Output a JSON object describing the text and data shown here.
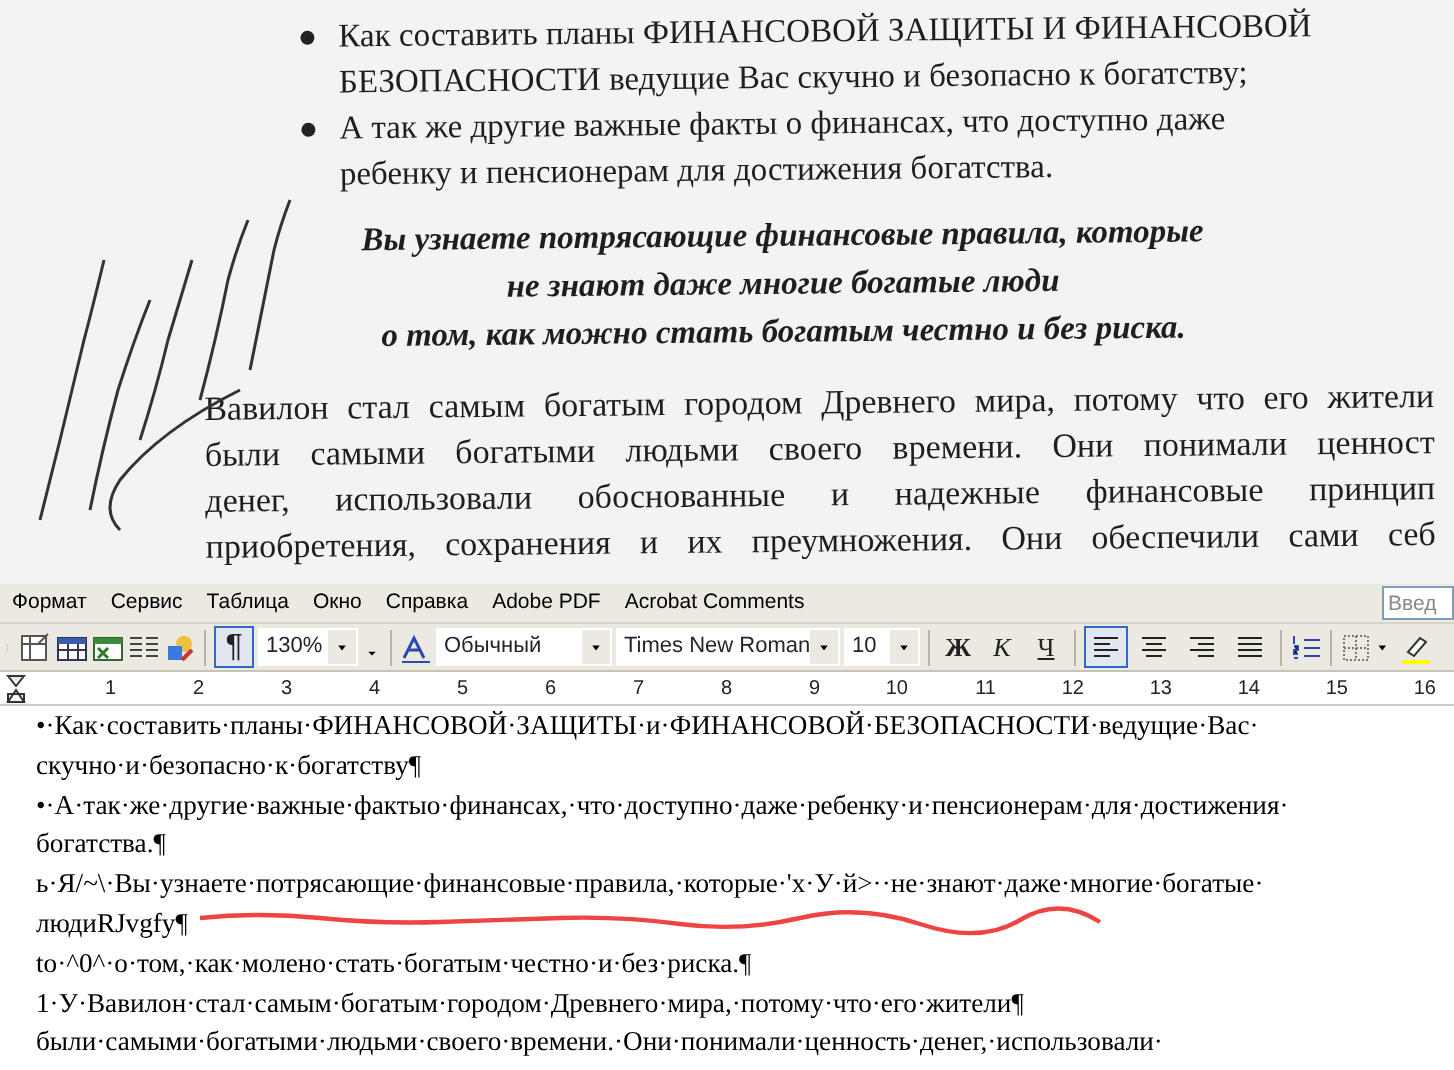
{
  "scan": {
    "bullets": [
      {
        "lines": [
          "Как составить планы ФИНАНСОВОЙ ЗАЩИТЫ И ФИНАНСОВОЙ",
          "БЕЗОПАСНОСТИ ведущие Вас скучно и безопасно к богатству;"
        ]
      },
      {
        "lines": [
          "А так же другие важные факты о финансах, что доступно даже",
          "ребенку и пенсионерам для достижения богатства."
        ]
      }
    ],
    "emphasis": [
      "Вы узнаете потрясающие финансовые правила, которые",
      "не знают даже многие богатые люди",
      "о том, как можно стать богатым честно и без риска."
    ],
    "paragraph": [
      "Вавилон стал самым богатым городом Древнего мира, потому что его жители",
      "были самыми богатыми людьми своего времени. Они понимали ценност",
      "денег, использовали обоснованные и надежные финансовые принцип",
      "приобретения, сохранения и их преумножения. Они обеспечили сами себ"
    ]
  },
  "menu": [
    {
      "label": "Формат"
    },
    {
      "label": "Сервис"
    },
    {
      "label": "Таблица"
    },
    {
      "label": "Окно"
    },
    {
      "label": "Справка"
    },
    {
      "label": "Adobe PDF"
    },
    {
      "label": "Acrobat Comments"
    }
  ],
  "help_box": {
    "placeholder": "Введ"
  },
  "toolbar": {
    "pilcrow": {
      "label": "¶",
      "selected": true
    },
    "zoom": "130%",
    "style": "Обычный",
    "font": "Times New Roman",
    "size": "10",
    "format_buttons": [
      {
        "label": "Ж",
        "selected": false
      },
      {
        "label": "К",
        "selected": false
      },
      {
        "label": "Ч",
        "selected": false
      }
    ],
    "align_buttons": [
      {
        "kind": "left",
        "selected": true
      },
      {
        "kind": "center",
        "selected": false
      },
      {
        "kind": "right",
        "selected": false
      },
      {
        "kind": "justify",
        "selected": false
      }
    ]
  },
  "ruler": {
    "ticks": [
      "1",
      "2",
      "3",
      "4",
      "5",
      "6",
      "7",
      "8",
      "9",
      "10",
      "11",
      "12",
      "13",
      "14",
      "15",
      "16"
    ]
  },
  "document": {
    "lines": [
      "•·Как·составить·планы·ФИНАНСОВОЙ·ЗАЩИТЫ·и·ФИНАНСОВОЙ·БЕЗОПАСНОСТИ·ведущие·Вас·",
      "скучно·и·безопасно·к·богатству¶",
      "•·А·так·же·другие·важные·фактыо·финансах,·что·доступно·даже·ребенку·и·пенсионерам·для·достижения·",
      "богатства.¶",
      "ь·Я/~\\·Вы·узнаете·потрясающие·финансовые·правила,·которые·'х·У·й>··не·знают·даже·многие·богатые·",
      "людиRJvgfy¶",
      "to·^0^·о·том,·как·молено·стать·богатым·честно·и·без·риска.¶",
      "1·У·Вавилон·стал·самым·богатым·городом·Древнего·мира,·потому·что·его·жители¶",
      "были·самыми·богатыми·людьми·своего·времени.·Они·понимали·ценность·денег,·использовали·"
    ]
  }
}
